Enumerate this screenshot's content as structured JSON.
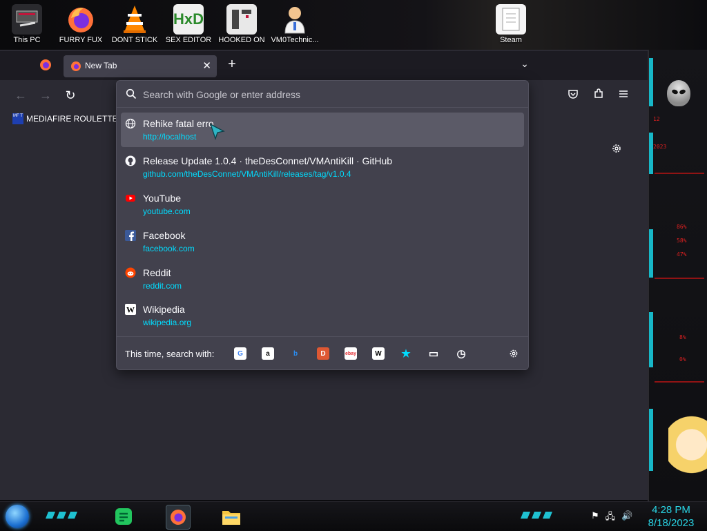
{
  "desktop_icons": [
    {
      "label": "This PC"
    },
    {
      "label": "FURRY FUX"
    },
    {
      "label": "DONT STICK"
    },
    {
      "label": "SEX EDITOR"
    },
    {
      "label": "HOOKED ON"
    },
    {
      "label": "VM0Technic..."
    },
    {
      "label": "Steam"
    }
  ],
  "browser": {
    "active_tab": {
      "title": "New Tab",
      "close": "✕"
    },
    "new_tab_symbol": "+",
    "tab_list_symbol": "⌄",
    "nav": {
      "back": "←",
      "forward": "→",
      "reload": "↻"
    },
    "bookmark": {
      "label": "MEDIAFIRE ROULETTER",
      "icon_text": "MF T"
    },
    "urlbar": {
      "placeholder": "Search with Google or enter address",
      "value": ""
    },
    "results": [
      {
        "title": "Rehike fatal erro",
        "url": "http://localhost",
        "icon": "globe-icon",
        "selected": true
      },
      {
        "title": "Release Update 1.0.4 · theDesConnet/VMAntiKill · GitHub",
        "url": "github.com/theDesConnet/VMAntiKill/releases/tag/v1.0.4",
        "icon": "github-icon"
      },
      {
        "title": "YouTube",
        "url": "youtube.com",
        "icon": "youtube-icon"
      },
      {
        "title": "Facebook",
        "url": "facebook.com",
        "icon": "facebook-icon"
      },
      {
        "title": "Reddit",
        "url": "reddit.com",
        "icon": "reddit-icon"
      },
      {
        "title": "Wikipedia",
        "url": "wikipedia.org",
        "icon": "wikipedia-icon"
      }
    ],
    "oneoff": {
      "label": "This time, search with:",
      "engines": [
        {
          "name": "google-engine-icon",
          "glyph": "G",
          "color": "#4285f4",
          "bg": "#ffffff"
        },
        {
          "name": "amazon-engine-icon",
          "glyph": "a",
          "color": "#000000",
          "bg": "#ffffff"
        },
        {
          "name": "bing-engine-icon",
          "glyph": "b",
          "color": "#2b8cf0",
          "bg": "transparent"
        },
        {
          "name": "duckduckgo-engine-icon",
          "glyph": "D",
          "color": "#ffffff",
          "bg": "#de5833"
        },
        {
          "name": "ebay-engine-icon",
          "glyph": "ebay",
          "color": "#e53238",
          "bg": "#ffffff"
        },
        {
          "name": "wikipedia-engine-icon",
          "glyph": "W",
          "color": "#000000",
          "bg": "#ffffff"
        },
        {
          "name": "bookmarks-star-icon",
          "glyph": "★",
          "color": "#00ddff",
          "bg": "transparent"
        },
        {
          "name": "tabs-icon",
          "glyph": "▭",
          "color": "#fbfbfe",
          "bg": "transparent"
        },
        {
          "name": "history-clock-icon",
          "glyph": "◷",
          "color": "#fbfbfe",
          "bg": "transparent"
        }
      ]
    }
  },
  "side_panel": {
    "readouts": [
      "12",
      "2023",
      "86%",
      "58%",
      "47%",
      "8%",
      "0%"
    ]
  },
  "taskbar": {
    "clock_time": "4:28 PM",
    "clock_date": "8/18/2023"
  },
  "colors": {
    "accent": "#00ddff",
    "popup_bg": "#42414d",
    "toolbar_bg": "#2b2a33"
  }
}
